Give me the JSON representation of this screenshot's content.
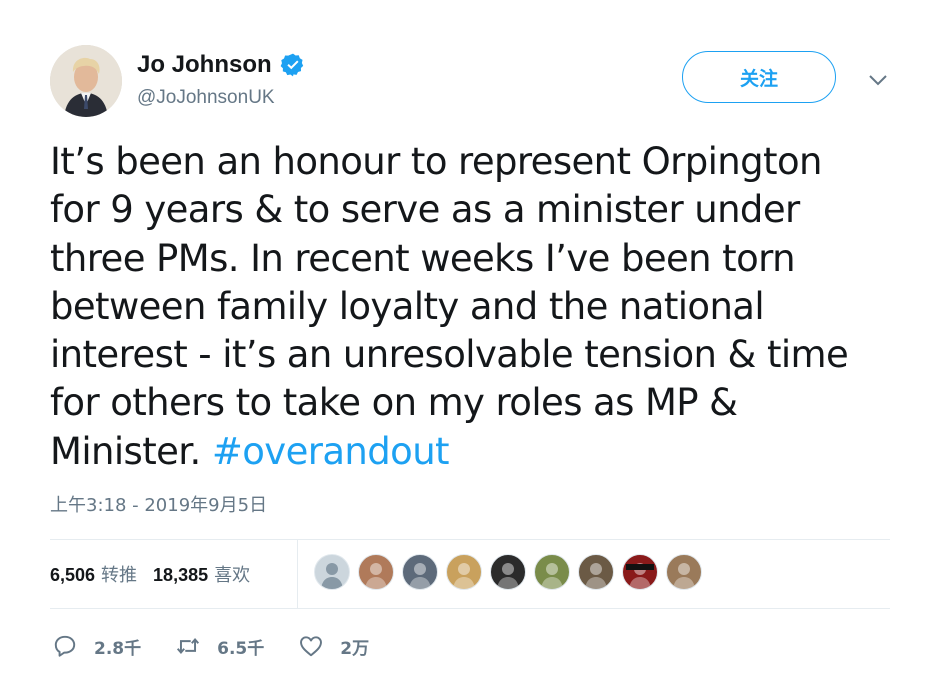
{
  "author": {
    "display_name": "Jo Johnson",
    "handle": "@JoJohnsonUK",
    "verified": true
  },
  "follow_button_label": "关注",
  "tweet": {
    "text_lines": [
      "It’s been an honour to represent Orpington",
      "for 9 years & to serve as a minister under",
      "three PMs. In recent weeks I’ve been torn",
      "between family loyalty and the national",
      "interest - it’s an unresolvable tension & time",
      "for others to take on my roles as MP &",
      "Minister."
    ],
    "hashtag": "#overandout",
    "timestamp": "上午3:18 - 2019年9月5日"
  },
  "stats": {
    "retweets_count": "6,506",
    "retweets_label": "转推",
    "likes_count": "18,385",
    "likes_label": "喜欢"
  },
  "likers": [
    {
      "icon": "default-avatar",
      "color": "#ccd6dd"
    },
    {
      "icon": "avatar",
      "color": "#b07a5a"
    },
    {
      "icon": "avatar",
      "color": "#5d6a7a"
    },
    {
      "icon": "avatar",
      "color": "#c9a15d"
    },
    {
      "icon": "avatar",
      "color": "#2b2b2b"
    },
    {
      "icon": "avatar",
      "color": "#7a8c4a"
    },
    {
      "icon": "avatar",
      "color": "#6b5a45"
    },
    {
      "icon": "avatar-betrayal",
      "color": "#8a1a1a"
    },
    {
      "icon": "avatar",
      "color": "#9a7a5a"
    }
  ],
  "actions": {
    "reply_count": "2.8千",
    "retweet_count": "6.5千",
    "like_count": "2万"
  },
  "colors": {
    "accent": "#1da1f2",
    "text": "#14171a",
    "secondary": "#657786",
    "divider": "#e6ecf0"
  }
}
